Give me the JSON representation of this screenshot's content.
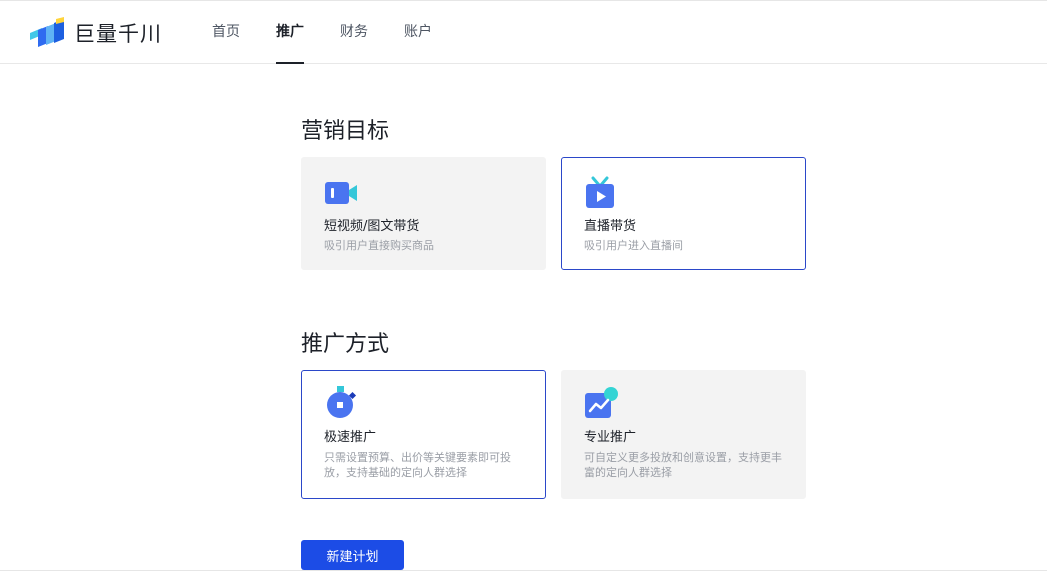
{
  "brand": {
    "name": "巨量千川",
    "accent": "#1c4ce6"
  },
  "nav": {
    "items": [
      {
        "label": "首页",
        "active": false
      },
      {
        "label": "推广",
        "active": true
      },
      {
        "label": "财务",
        "active": false
      },
      {
        "label": "账户",
        "active": false
      }
    ]
  },
  "marketing_goal": {
    "title": "营销目标",
    "options": [
      {
        "icon": "video-camera-icon",
        "title": "短视频/图文带货",
        "desc": "吸引用户直接购买商品",
        "selected": false
      },
      {
        "icon": "live-tv-icon",
        "title": "直播带货",
        "desc": "吸引用户进入直播间",
        "selected": true
      }
    ]
  },
  "promotion_method": {
    "title": "推广方式",
    "options": [
      {
        "icon": "stopwatch-icon",
        "title": "极速推广",
        "desc": "只需设置预算、出价等关键要素即可投放，支持基础的定向人群选择",
        "selected": true
      },
      {
        "icon": "trend-chart-icon",
        "title": "专业推广",
        "desc": "可自定义更多投放和创意设置，支持更丰富的定向人群选择",
        "selected": false
      }
    ]
  },
  "actions": {
    "create_plan_label": "新建计划"
  }
}
